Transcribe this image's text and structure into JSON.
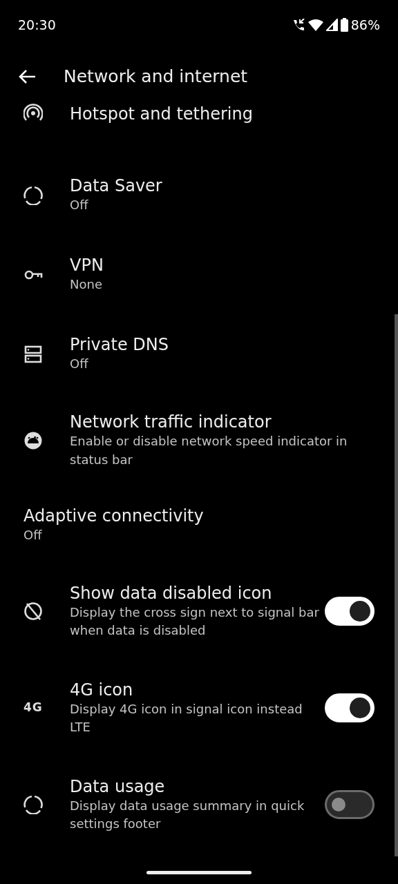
{
  "status_bar": {
    "time": "20:30",
    "battery": "86%"
  },
  "header": {
    "title": "Network and internet"
  },
  "items": [
    {
      "kind": "link",
      "title": "Hotspot and tethering"
    },
    {
      "kind": "link",
      "title": "Data Saver",
      "summary": "Off"
    },
    {
      "kind": "link",
      "title": "VPN",
      "summary": "None"
    },
    {
      "kind": "link",
      "title": "Private DNS",
      "summary": "Off"
    },
    {
      "kind": "link",
      "title": "Network traffic indicator",
      "summary": "Enable or disable network speed indicator in status bar"
    },
    {
      "kind": "plain",
      "title": "Adaptive connectivity",
      "summary": "Off"
    },
    {
      "kind": "toggle",
      "title": "Show data disabled icon",
      "summary": "Display the cross sign next to signal bar when data is disabled",
      "on": true
    },
    {
      "kind": "toggle",
      "title": "4G icon",
      "summary": "Display 4G icon in signal icon instead LTE",
      "on": true,
      "icon_text": "4G"
    },
    {
      "kind": "toggle",
      "title": "Data usage",
      "summary": "Display data usage summary in quick settings footer",
      "on": false
    }
  ]
}
